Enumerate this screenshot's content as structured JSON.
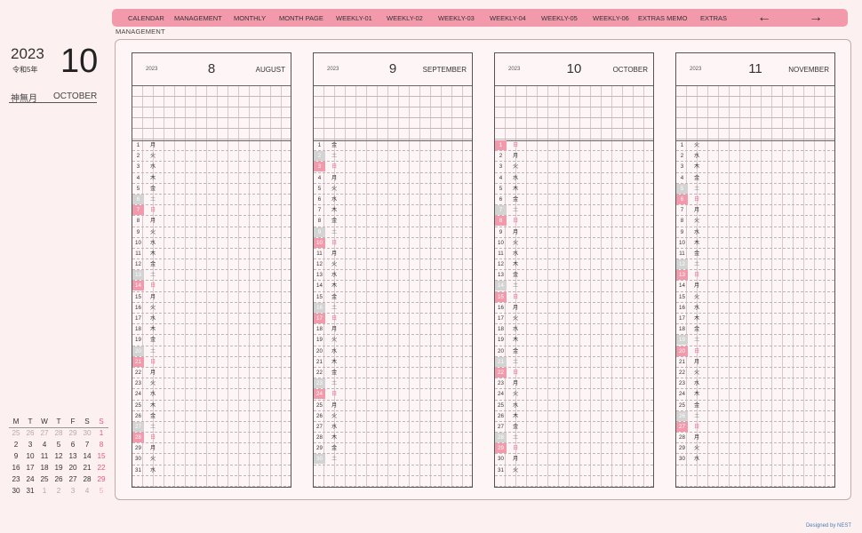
{
  "nav": {
    "items": [
      "CALENDAR",
      "MANAGEMENT",
      "MONTHLY",
      "MONTH PAGE",
      "WEEKLY-01",
      "WEEKLY-02",
      "WEEKLY-03",
      "WEEKLY-04",
      "WEEKLY-05",
      "WEEKLY-06",
      "EXTRAS MEMO",
      "EXTRAS"
    ],
    "prev": "←",
    "next": "→"
  },
  "page_label": "MANAGEMENT",
  "side": {
    "year": "2023",
    "era": "令和5年",
    "month": "10",
    "month_jp": "神無月",
    "month_en": "OCTOBER"
  },
  "minical": {
    "headers": [
      "M",
      "T",
      "W",
      "T",
      "F",
      "S",
      "S"
    ],
    "rows": [
      [
        "25",
        "26",
        "27",
        "28",
        "29",
        "30",
        "1"
      ],
      [
        "2",
        "3",
        "4",
        "5",
        "6",
        "7",
        "8"
      ],
      [
        "9",
        "10",
        "11",
        "12",
        "13",
        "14",
        "15"
      ],
      [
        "16",
        "17",
        "18",
        "19",
        "20",
        "21",
        "22"
      ],
      [
        "23",
        "24",
        "25",
        "26",
        "27",
        "28",
        "29"
      ],
      [
        "30",
        "31",
        "1",
        "2",
        "3",
        "4",
        "5"
      ]
    ]
  },
  "months": [
    {
      "year": "2023",
      "num": "8",
      "name": "AUGUST",
      "days": 31,
      "first_wd": 1
    },
    {
      "year": "2023",
      "num": "9",
      "name": "SEPTEMBER",
      "days": 30,
      "first_wd": 5
    },
    {
      "year": "2023",
      "num": "10",
      "name": "OCTOBER",
      "days": 31,
      "first_wd": 0
    },
    {
      "year": "2023",
      "num": "11",
      "name": "NOVEMBER",
      "days": 30,
      "first_wd": 2
    }
  ],
  "weekday_jp": [
    "日",
    "月",
    "火",
    "水",
    "木",
    "金",
    "土"
  ],
  "colors": {
    "accent": "#f29aab",
    "saturday": "#d3d3d3",
    "sunday": "#f29aab",
    "background": "#fdf0f1"
  },
  "credit": "Designed by NEST"
}
